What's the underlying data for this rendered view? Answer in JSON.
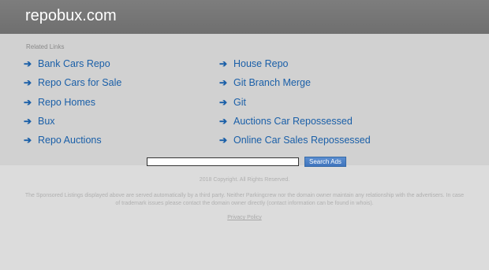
{
  "site": {
    "title": "repobux.com"
  },
  "related": {
    "label": "Related Links",
    "left": [
      "Bank Cars Repo",
      "Repo Cars for Sale",
      "Repo Homes",
      "Bux",
      "Repo Auctions"
    ],
    "right": [
      "House Repo",
      "Git Branch Merge",
      "Git",
      "Auctions Car Repossessed",
      "Online Car Sales Repossessed"
    ]
  },
  "search": {
    "value": "",
    "button_label": "Search Ads"
  },
  "footer": {
    "copyright": "2018 Copyright. All Rights Reserved.",
    "disclaimer": "The Sponsored Listings displayed above are served automatically by a third party. Neither Parkingcrew nor the domain owner maintain any relationship with the advertisers. In case of trademark issues please contact the domain owner directly (contact information can be found in whois).",
    "privacy": "Privacy Policy"
  },
  "colors": {
    "header": "#757575",
    "link": "#1a5fa8",
    "background": "#dcdcdc"
  }
}
